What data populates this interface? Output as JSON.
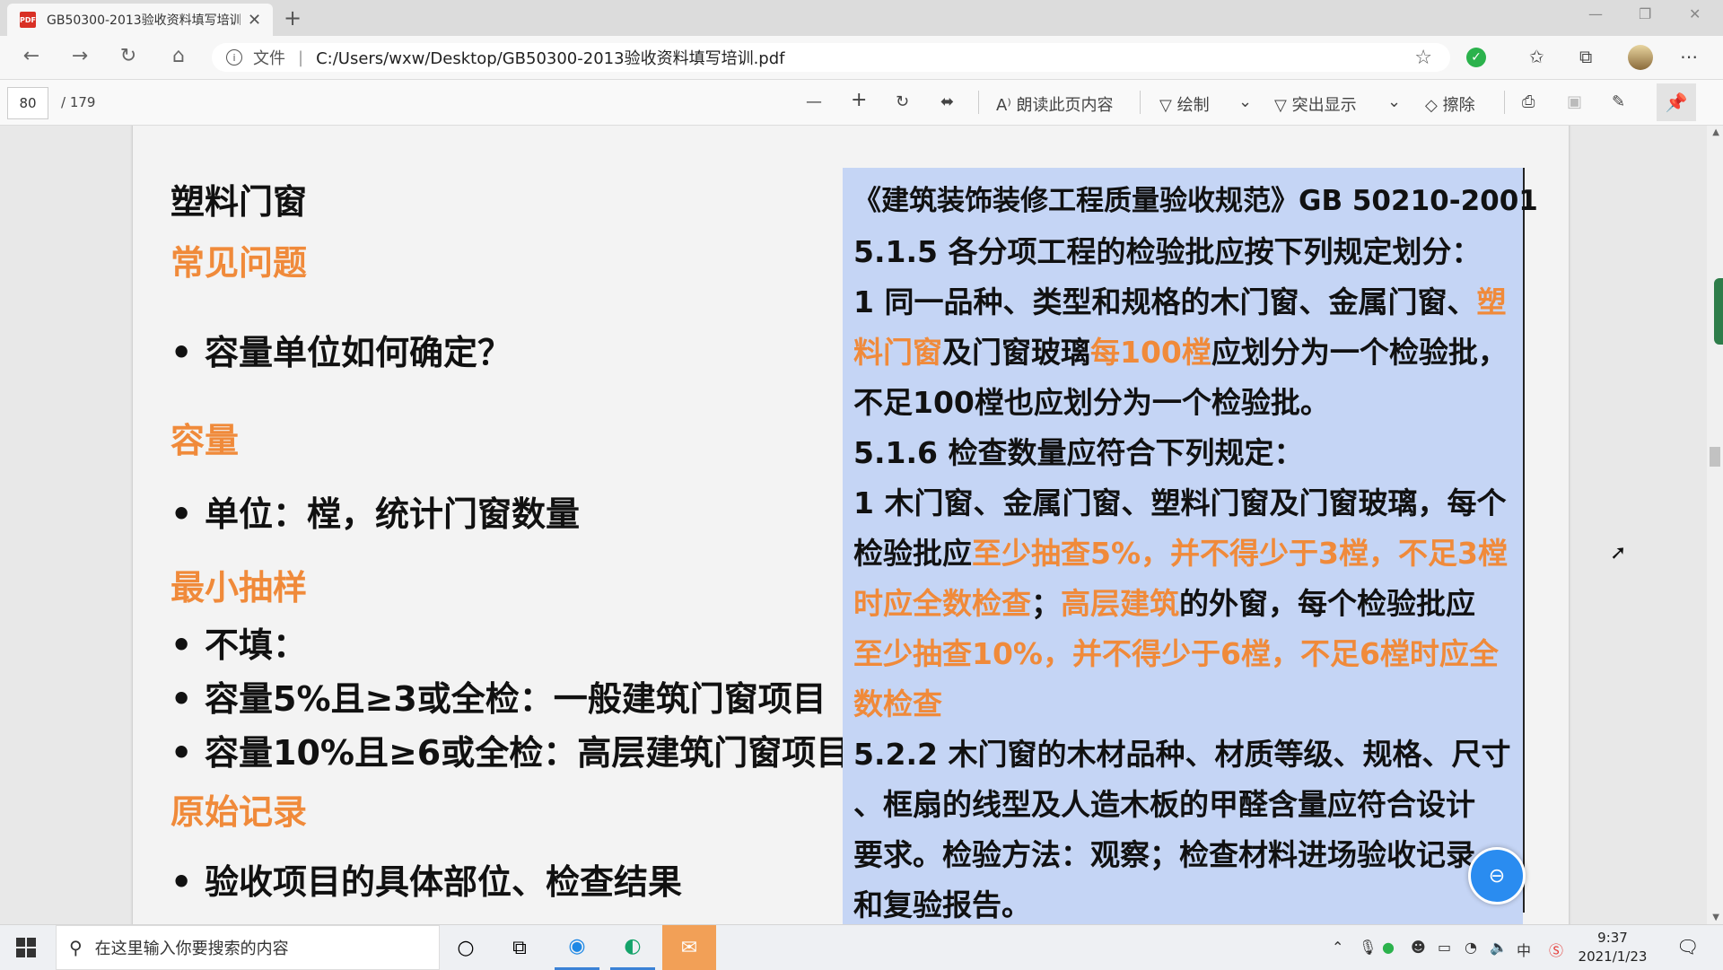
{
  "browser": {
    "tab_title": "GB50300-2013验收资料填写培训",
    "pdf_icon_label": "PDF",
    "url_prefix": "文件",
    "url": "C:/Users/wxw/Desktop/GB50300-2013验收资料填写培训.pdf"
  },
  "pdf_toolbar": {
    "current_page": "80",
    "total_pages": "/ 179",
    "read_aloud_label": "朗读此页内容",
    "draw_label": "绘制",
    "highlight_label": "突出显示",
    "erase_label": "擦除"
  },
  "slide": {
    "title": "塑料门窗",
    "left": {
      "heading_issues": "常见问题",
      "bullet_capacity_unit": "容量单位如何确定？",
      "heading_capacity": "容量",
      "bullet_unit": "单位：樘，统计门窗数量",
      "heading_min_sample": "最小抽样",
      "bullet_not_fill": "不填：",
      "bullet_5pct": "容量5%且≥3或全检：一般建筑门窗项目",
      "bullet_10pct": "容量10%且≥6或全检：高层建筑门窗项目",
      "heading_original": "原始记录",
      "bullet_record": "验收项目的具体部位、检查结果"
    },
    "right": {
      "line1": "《建筑装饰装修工程质量验收规范》GB 50210-2001",
      "line2": "5.1.5 各分项工程的检验批应按下列规定划分：",
      "line3a": "1 同一品种、类型和规格的木门窗、金属门窗、",
      "line3b": "塑",
      "line4a": "料门窗",
      "line4b": "及门窗玻璃",
      "line4c": "每100樘",
      "line4d": "应划分为一个检验批，",
      "line5": "不足100樘也应划分为一个检验批。",
      "line6": "5.1.6 检查数量应符合下列规定：",
      "line7": "1 木门窗、金属门窗、塑料门窗及门窗玻璃，每个",
      "line8a": "检验批应",
      "line8b": "至少抽查5%，并不得少于3樘，不足3樘",
      "line9a": "时应全数检查",
      "line9b": "；",
      "line9c": "高层建筑",
      "line9d": "的外窗，每个检验批应",
      "line10": "至少抽查10%，并不得少于6樘，不足6樘时应全",
      "line11": "数检查",
      "line12": "5.2.2 木门窗的木材品种、材质等级、规格、尺寸",
      "line13": "、框扇的线型及人造木板的甲醛含量应符合设计",
      "line14": "要求。检验方法：观察；检查材料进场验收记录",
      "line15": "和复验报告。"
    }
  },
  "taskbar": {
    "search_placeholder": "在这里输入你要搜索的内容",
    "ime_label": "中",
    "time": "9:37",
    "date": "2021/1/23"
  },
  "colors": {
    "accent_orange": "#f08a3a",
    "panel_blue": "#c5d5f5"
  }
}
